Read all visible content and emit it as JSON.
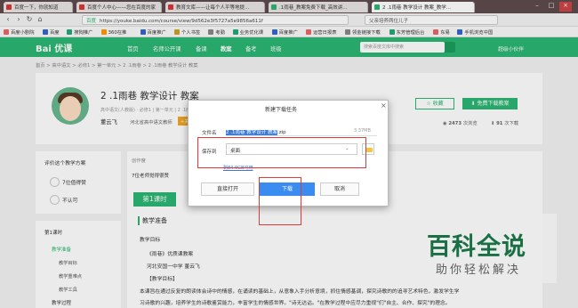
{
  "browser": {
    "tabs": [
      {
        "label": "百度一下，你就知道"
      },
      {
        "label": "百度个人中心——您在百度的家"
      },
      {
        "label": "教育文库——让每个人平等地提..."
      },
      {
        "label": ".1雨巷_教案免费下载_高效讲..."
      },
      {
        "label": "2 .1雨巷 教学设计 教案_教学..."
      }
    ],
    "address_prefix": "百度",
    "url": "https://youke.baidu.com/course/view/9d562e3f5727a5e9856a611f",
    "search_placeholder": "父亲培养两位儿子",
    "bookmarks": [
      "百度小剧院",
      "百度",
      "搜狗推广",
      "360在推",
      "百度推广",
      "个人书签",
      "考勤",
      "业务优化课",
      "百度推广",
      "运营日报表",
      "领金链接下载",
      "东芳管理后台",
      "东易",
      "手机浏览中国"
    ]
  },
  "site": {
    "logo": "Bai 优课",
    "nav": [
      "首页",
      "名师公开课",
      "备课",
      "教案",
      "备考",
      "班级"
    ],
    "search_placeholder": "搜索百度文库中搜索",
    "user": "超级小伙伴"
  },
  "breadcrumb": "首页 > 高中语文 > 必修1 > 第一单元 > 2 .1雨巷 > 2 .1雨巷 教学设计 教案",
  "doc": {
    "title": "2 .1雨巷 教学设计 教案",
    "meta": "高中语文(人教版) · 必修1 | 第一单元 | 2 .1雨巷",
    "author": "董云飞",
    "school": "河北省高中语文教师",
    "badge": "+关注",
    "fav_label": "收藏",
    "download_label": "免费下载教案",
    "views": "2473",
    "views_label": "次浏览",
    "downloads": "91",
    "downloads_label": "次下载"
  },
  "evaluate": {
    "title": "评价这个教学方案",
    "good": "7位值得赞",
    "bad": "不认可"
  },
  "toc": {
    "lesson": "第1课时",
    "items": [
      "教学准备",
      "教学目标",
      "教学重难点",
      "教学工具",
      "教学过程"
    ]
  },
  "main": {
    "creator_label": "创作度",
    "recommend": "7位老师觉得很赞",
    "tab": "第1课时",
    "section": "教学准备",
    "lines": [
      "教学目标",
      "《雨巷》优质课教案",
      "河北安国一中学 董云飞",
      "【教学目标】",
      "本课旨在通过反复的朗读体会诗中的情感，在诵读的基础上，从意象入手分析意境，抓住情感基调，探究诗歌的的追寻艺术特色，激发学生学",
      "习诗歌的兴趣，培养学生的诗歌鉴赏能力，丰富学生的情感世界。\"诗无达诂。\"在教学过程中应尽力重视\"们\"自主、合作、探究\"的理念。"
    ]
  },
  "dialog": {
    "title": "新建下载任务",
    "filename_label": "文件名",
    "filename_selected": "2 .1雨巷 教学设计 教案",
    "filename_ext": ".zip",
    "filesize": "3.37MB",
    "saveto_label": "保存到",
    "saveto_value": "桌面",
    "link": "剩84.9GB可用",
    "open_label": "直接打开",
    "download_label": "下载",
    "cancel_label": "取消"
  },
  "watermark": {
    "big": "百科全说",
    "small": "助你轻松解决"
  },
  "colors": {
    "brand_green": "#2bb673",
    "dialog_blue": "#3b8cf1",
    "highlight_red": "#e03a3a"
  }
}
